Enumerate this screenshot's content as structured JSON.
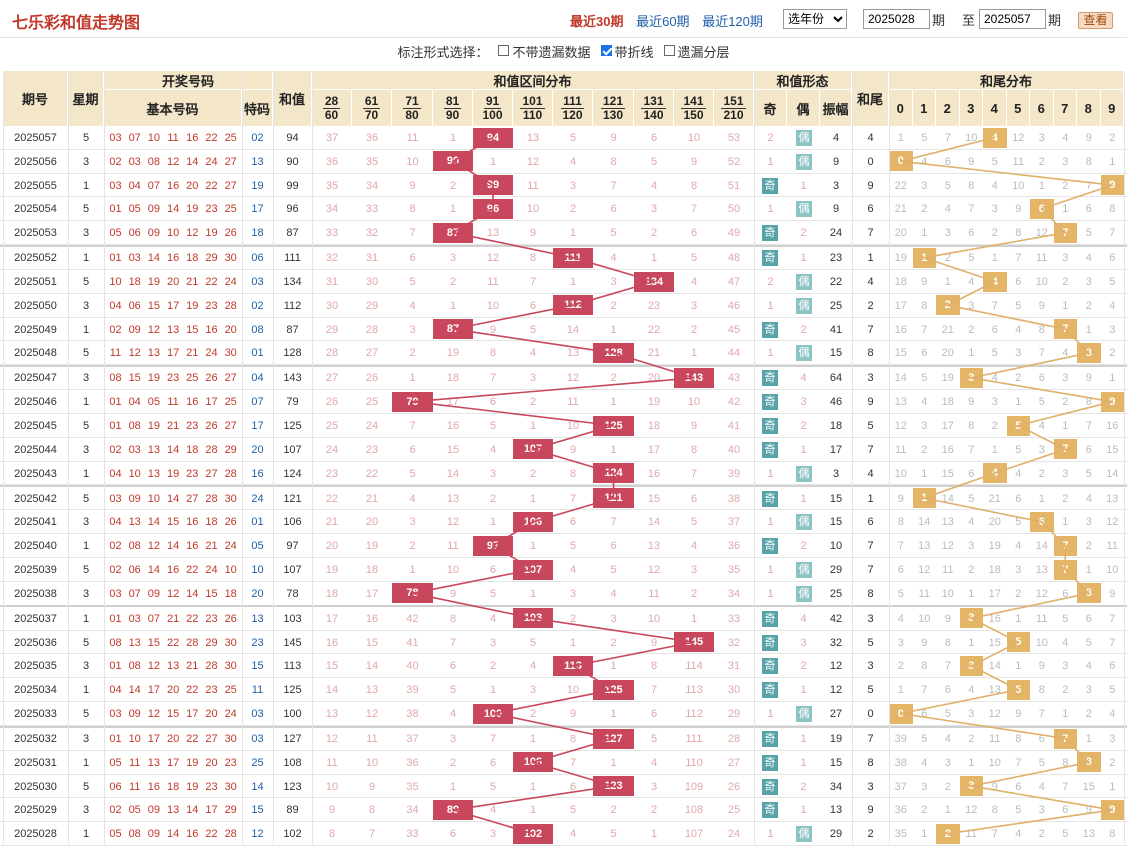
{
  "title": "七乐彩和值走势图",
  "periods": [
    "最近30期",
    "最近60期",
    "最近120期"
  ],
  "year_select": "选年份",
  "range": {
    "from": "2025028",
    "to": "2025057",
    "period_unit": "期",
    "to_label": "至",
    "query": "查看"
  },
  "options": {
    "label": "标注形式选择：",
    "items": [
      {
        "text": "不带遗漏数据",
        "checked": false
      },
      {
        "text": "带折线",
        "checked": true
      },
      {
        "text": "遗漏分层",
        "checked": false
      }
    ]
  },
  "headers": {
    "issue": "期号",
    "week": "星期",
    "draw": "开奖号码",
    "basic": "基本号码",
    "special": "特码",
    "sum": "和值",
    "range_dist": "和值区间分布",
    "form": "和值形态",
    "odd": "奇",
    "even": "偶",
    "amp": "振幅",
    "tail": "和尾",
    "tail_dist": "和尾分布"
  },
  "ranges": [
    [
      "28",
      "60"
    ],
    [
      "61",
      "70"
    ],
    [
      "71",
      "80"
    ],
    [
      "81",
      "90"
    ],
    [
      "91",
      "100"
    ],
    [
      "101",
      "110"
    ],
    [
      "111",
      "120"
    ],
    [
      "121",
      "130"
    ],
    [
      "131",
      "140"
    ],
    [
      "141",
      "150"
    ],
    [
      "151",
      "210"
    ]
  ],
  "tail_digits": [
    "0",
    "1",
    "2",
    "3",
    "4",
    "5",
    "6",
    "7",
    "8",
    "9"
  ],
  "colors": {
    "hit": "#c9475c",
    "tail_hit": "#e5b567",
    "tail_line": "#e0b06a",
    "header": "#f3e6c9"
  },
  "rows": [
    {
      "issue": "2025057",
      "week": "5",
      "nums": [
        "03",
        "07",
        "10",
        "11",
        "16",
        "22",
        "25"
      ],
      "sp": "02",
      "sum": "94",
      "r": [
        "37",
        "36",
        "11",
        "1",
        null,
        "13",
        "5",
        "9",
        "6",
        "10",
        "53"
      ],
      "odd": "2",
      "even": null,
      "amp": "4",
      "tail": "4",
      "t": [
        "1",
        "5",
        "7",
        "10",
        null,
        "12",
        "3",
        "4",
        "9",
        "2"
      ]
    },
    {
      "issue": "2025056",
      "week": "3",
      "nums": [
        "02",
        "03",
        "08",
        "12",
        "14",
        "24",
        "27"
      ],
      "sp": "13",
      "sum": "90",
      "r": [
        "36",
        "35",
        "10",
        null,
        "1",
        "12",
        "4",
        "8",
        "5",
        "9",
        "52"
      ],
      "odd": "1",
      "even": null,
      "amp": "9",
      "tail": "0",
      "t": [
        null,
        "4",
        "6",
        "9",
        "5",
        "11",
        "2",
        "3",
        "8",
        "1"
      ]
    },
    {
      "issue": "2025055",
      "week": "1",
      "nums": [
        "03",
        "04",
        "07",
        "16",
        "20",
        "22",
        "27"
      ],
      "sp": "19",
      "sum": "99",
      "r": [
        "35",
        "34",
        "9",
        "2",
        null,
        "11",
        "3",
        "7",
        "4",
        "8",
        "51"
      ],
      "odd": null,
      "even": "1",
      "amp": "3",
      "tail": "9",
      "t": [
        "22",
        "3",
        "5",
        "8",
        "4",
        "10",
        "1",
        "2",
        "7",
        null
      ]
    },
    {
      "issue": "2025054",
      "week": "5",
      "nums": [
        "01",
        "05",
        "09",
        "14",
        "19",
        "23",
        "25"
      ],
      "sp": "17",
      "sum": "96",
      "r": [
        "34",
        "33",
        "8",
        "1",
        null,
        "10",
        "2",
        "6",
        "3",
        "7",
        "50"
      ],
      "odd": "1",
      "even": null,
      "amp": "9",
      "tail": "6",
      "t": [
        "21",
        "2",
        "4",
        "7",
        "3",
        "9",
        null,
        "1",
        "6",
        "8"
      ]
    },
    {
      "issue": "2025053",
      "week": "3",
      "nums": [
        "05",
        "06",
        "09",
        "10",
        "12",
        "19",
        "26"
      ],
      "sp": "18",
      "sum": "87",
      "r": [
        "33",
        "32",
        "7",
        null,
        "13",
        "9",
        "1",
        "5",
        "2",
        "6",
        "49"
      ],
      "odd": null,
      "even": "2",
      "amp": "24",
      "tail": "7",
      "t": [
        "20",
        "1",
        "3",
        "6",
        "2",
        "8",
        "12",
        null,
        "5",
        "7"
      ]
    },
    {
      "issue": "2025052",
      "week": "1",
      "nums": [
        "01",
        "03",
        "14",
        "16",
        "18",
        "29",
        "30"
      ],
      "sp": "06",
      "sum": "111",
      "r": [
        "32",
        "31",
        "6",
        "3",
        "12",
        "8",
        null,
        "4",
        "1",
        "5",
        "48"
      ],
      "odd": null,
      "even": "1",
      "amp": "23",
      "tail": "1",
      "t": [
        "19",
        null,
        "2",
        "5",
        "1",
        "7",
        "11",
        "3",
        "4",
        "6"
      ]
    },
    {
      "issue": "2025051",
      "week": "5",
      "nums": [
        "10",
        "18",
        "19",
        "20",
        "21",
        "22",
        "24"
      ],
      "sp": "03",
      "sum": "134",
      "r": [
        "31",
        "30",
        "5",
        "2",
        "11",
        "7",
        "1",
        "3",
        null,
        "4",
        "47"
      ],
      "odd": "2",
      "even": null,
      "amp": "22",
      "tail": "4",
      "t": [
        "18",
        "9",
        "1",
        "4",
        null,
        "6",
        "10",
        "2",
        "3",
        "5"
      ]
    },
    {
      "issue": "2025050",
      "week": "3",
      "nums": [
        "04",
        "06",
        "15",
        "17",
        "19",
        "23",
        "28"
      ],
      "sp": "02",
      "sum": "112",
      "r": [
        "30",
        "29",
        "4",
        "1",
        "10",
        "6",
        null,
        "2",
        "23",
        "3",
        "46"
      ],
      "odd": "1",
      "even": null,
      "amp": "25",
      "tail": "2",
      "t": [
        "17",
        "8",
        null,
        "3",
        "7",
        "5",
        "9",
        "1",
        "2",
        "4"
      ]
    },
    {
      "issue": "2025049",
      "week": "1",
      "nums": [
        "02",
        "09",
        "12",
        "13",
        "15",
        "16",
        "20"
      ],
      "sp": "08",
      "sum": "87",
      "r": [
        "29",
        "28",
        "3",
        null,
        "9",
        "5",
        "14",
        "1",
        "22",
        "2",
        "45"
      ],
      "odd": null,
      "even": "2",
      "amp": "41",
      "tail": "7",
      "t": [
        "16",
        "7",
        "21",
        "2",
        "6",
        "4",
        "8",
        null,
        "1",
        "3"
      ]
    },
    {
      "issue": "2025048",
      "week": "5",
      "nums": [
        "11",
        "12",
        "13",
        "17",
        "21",
        "24",
        "30"
      ],
      "sp": "01",
      "sum": "128",
      "r": [
        "28",
        "27",
        "2",
        "19",
        "8",
        "4",
        "13",
        null,
        "21",
        "1",
        "44"
      ],
      "odd": "1",
      "even": null,
      "amp": "15",
      "tail": "8",
      "t": [
        "15",
        "6",
        "20",
        "1",
        "5",
        "3",
        "7",
        "4",
        null,
        "2"
      ]
    },
    {
      "issue": "2025047",
      "week": "3",
      "nums": [
        "08",
        "15",
        "19",
        "23",
        "25",
        "26",
        "27"
      ],
      "sp": "04",
      "sum": "143",
      "r": [
        "27",
        "26",
        "1",
        "18",
        "7",
        "3",
        "12",
        "2",
        "20",
        null,
        "43"
      ],
      "odd": null,
      "even": "4",
      "amp": "64",
      "tail": "3",
      "t": [
        "14",
        "5",
        "19",
        null,
        "4",
        "2",
        "6",
        "3",
        "9",
        "1"
      ]
    },
    {
      "issue": "2025046",
      "week": "1",
      "nums": [
        "01",
        "04",
        "05",
        "11",
        "16",
        "17",
        "25"
      ],
      "sp": "07",
      "sum": "79",
      "r": [
        "26",
        "25",
        null,
        "17",
        "6",
        "2",
        "11",
        "1",
        "19",
        "10",
        "42"
      ],
      "odd": null,
      "even": "3",
      "amp": "46",
      "tail": "9",
      "t": [
        "13",
        "4",
        "18",
        "9",
        "3",
        "1",
        "5",
        "2",
        "8",
        null
      ]
    },
    {
      "issue": "2025045",
      "week": "5",
      "nums": [
        "01",
        "08",
        "19",
        "21",
        "23",
        "26",
        "27"
      ],
      "sp": "17",
      "sum": "125",
      "r": [
        "25",
        "24",
        "7",
        "16",
        "5",
        "1",
        "10",
        null,
        "18",
        "9",
        "41"
      ],
      "odd": null,
      "even": "2",
      "amp": "18",
      "tail": "5",
      "t": [
        "12",
        "3",
        "17",
        "8",
        "2",
        null,
        "4",
        "1",
        "7",
        "16"
      ]
    },
    {
      "issue": "2025044",
      "week": "3",
      "nums": [
        "02",
        "03",
        "13",
        "14",
        "18",
        "28",
        "29"
      ],
      "sp": "20",
      "sum": "107",
      "r": [
        "24",
        "23",
        "6",
        "15",
        "4",
        null,
        "9",
        "1",
        "17",
        "8",
        "40"
      ],
      "odd": null,
      "even": "1",
      "amp": "17",
      "tail": "7",
      "t": [
        "11",
        "2",
        "16",
        "7",
        "1",
        "5",
        "3",
        null,
        "6",
        "15"
      ]
    },
    {
      "issue": "2025043",
      "week": "1",
      "nums": [
        "04",
        "10",
        "13",
        "19",
        "23",
        "27",
        "28"
      ],
      "sp": "16",
      "sum": "124",
      "r": [
        "23",
        "22",
        "5",
        "14",
        "3",
        "2",
        "8",
        null,
        "16",
        "7",
        "39"
      ],
      "odd": "1",
      "even": null,
      "amp": "3",
      "tail": "4",
      "t": [
        "10",
        "1",
        "15",
        "6",
        null,
        "4",
        "2",
        "3",
        "5",
        "14"
      ]
    },
    {
      "issue": "2025042",
      "week": "5",
      "nums": [
        "03",
        "09",
        "10",
        "14",
        "27",
        "28",
        "30"
      ],
      "sp": "24",
      "sum": "121",
      "r": [
        "22",
        "21",
        "4",
        "13",
        "2",
        "1",
        "7",
        null,
        "15",
        "6",
        "38"
      ],
      "odd": null,
      "even": "1",
      "amp": "15",
      "tail": "1",
      "t": [
        "9",
        null,
        "14",
        "5",
        "21",
        "6",
        "1",
        "2",
        "4",
        "13"
      ]
    },
    {
      "issue": "2025041",
      "week": "3",
      "nums": [
        "04",
        "13",
        "14",
        "15",
        "16",
        "18",
        "26"
      ],
      "sp": "01",
      "sum": "106",
      "r": [
        "21",
        "20",
        "3",
        "12",
        "1",
        null,
        "6",
        "7",
        "14",
        "5",
        "37"
      ],
      "odd": "1",
      "even": null,
      "amp": "15",
      "tail": "6",
      "t": [
        "8",
        "14",
        "13",
        "4",
        "20",
        "5",
        null,
        "1",
        "3",
        "12"
      ]
    },
    {
      "issue": "2025040",
      "week": "1",
      "nums": [
        "02",
        "08",
        "12",
        "14",
        "16",
        "21",
        "24"
      ],
      "sp": "05",
      "sum": "97",
      "r": [
        "20",
        "19",
        "2",
        "11",
        null,
        "1",
        "5",
        "6",
        "13",
        "4",
        "36"
      ],
      "odd": null,
      "even": "2",
      "amp": "10",
      "tail": "7",
      "t": [
        "7",
        "13",
        "12",
        "3",
        "19",
        "4",
        "14",
        null,
        "2",
        "11"
      ]
    },
    {
      "issue": "2025039",
      "week": "5",
      "nums": [
        "02",
        "06",
        "14",
        "16",
        "22",
        "24",
        "10"
      ],
      "sp": "10",
      "sum": "107",
      "r": [
        "19",
        "18",
        "1",
        "10",
        "6",
        null,
        "4",
        "5",
        "12",
        "3",
        "35"
      ],
      "odd": "1",
      "even": null,
      "amp": "29",
      "tail": "7",
      "t": [
        "6",
        "12",
        "11",
        "2",
        "18",
        "3",
        "13",
        null,
        "1",
        "10"
      ]
    },
    {
      "issue": "2025038",
      "week": "3",
      "nums": [
        "03",
        "07",
        "09",
        "12",
        "14",
        "15",
        "18"
      ],
      "sp": "20",
      "sum": "78",
      "r": [
        "18",
        "17",
        null,
        "9",
        "5",
        "1",
        "3",
        "4",
        "11",
        "2",
        "34"
      ],
      "odd": "1",
      "even": null,
      "amp": "25",
      "tail": "8",
      "t": [
        "5",
        "11",
        "10",
        "1",
        "17",
        "2",
        "12",
        "6",
        null,
        "9"
      ]
    },
    {
      "issue": "2025037",
      "week": "1",
      "nums": [
        "01",
        "03",
        "07",
        "21",
        "22",
        "23",
        "26"
      ],
      "sp": "13",
      "sum": "103",
      "r": [
        "17",
        "16",
        "42",
        "8",
        "4",
        null,
        "2",
        "3",
        "10",
        "1",
        "33"
      ],
      "odd": null,
      "even": "4",
      "amp": "42",
      "tail": "3",
      "t": [
        "4",
        "10",
        "9",
        null,
        "16",
        "1",
        "11",
        "5",
        "6",
        "7"
      ]
    },
    {
      "issue": "2025036",
      "week": "5",
      "nums": [
        "08",
        "13",
        "15",
        "22",
        "28",
        "29",
        "30"
      ],
      "sp": "23",
      "sum": "145",
      "r": [
        "16",
        "15",
        "41",
        "7",
        "3",
        "5",
        "1",
        "2",
        "9",
        null,
        "32"
      ],
      "odd": null,
      "even": "3",
      "amp": "32",
      "tail": "5",
      "t": [
        "3",
        "9",
        "8",
        "1",
        "15",
        null,
        "10",
        "4",
        "5",
        "7"
      ]
    },
    {
      "issue": "2025035",
      "week": "3",
      "nums": [
        "01",
        "08",
        "12",
        "13",
        "21",
        "28",
        "30"
      ],
      "sp": "15",
      "sum": "113",
      "r": [
        "15",
        "14",
        "40",
        "6",
        "2",
        "4",
        null,
        "1",
        "8",
        "114",
        "31"
      ],
      "odd": null,
      "even": "2",
      "amp": "12",
      "tail": "3",
      "t": [
        "2",
        "8",
        "7",
        null,
        "14",
        "1",
        "9",
        "3",
        "4",
        "6"
      ]
    },
    {
      "issue": "2025034",
      "week": "1",
      "nums": [
        "04",
        "14",
        "17",
        "20",
        "22",
        "23",
        "25"
      ],
      "sp": "11",
      "sum": "125",
      "r": [
        "14",
        "13",
        "39",
        "5",
        "1",
        "3",
        "10",
        null,
        "7",
        "113",
        "30"
      ],
      "odd": null,
      "even": "1",
      "amp": "12",
      "tail": "5",
      "t": [
        "1",
        "7",
        "6",
        "4",
        "13",
        null,
        "8",
        "2",
        "3",
        "5"
      ]
    },
    {
      "issue": "2025033",
      "week": "5",
      "nums": [
        "03",
        "09",
        "12",
        "15",
        "17",
        "20",
        "24"
      ],
      "sp": "03",
      "sum": "100",
      "r": [
        "13",
        "12",
        "38",
        "4",
        null,
        "2",
        "9",
        "1",
        "6",
        "112",
        "29"
      ],
      "odd": "1",
      "even": null,
      "amp": "27",
      "tail": "0",
      "t": [
        null,
        "6",
        "5",
        "3",
        "12",
        "9",
        "7",
        "1",
        "2",
        "4"
      ]
    },
    {
      "issue": "2025032",
      "week": "3",
      "nums": [
        "01",
        "10",
        "17",
        "20",
        "22",
        "27",
        "30"
      ],
      "sp": "03",
      "sum": "127",
      "r": [
        "12",
        "11",
        "37",
        "3",
        "7",
        "1",
        "8",
        null,
        "5",
        "111",
        "28"
      ],
      "odd": null,
      "even": "1",
      "amp": "19",
      "tail": "7",
      "t": [
        "39",
        "5",
        "4",
        "2",
        "11",
        "8",
        "6",
        null,
        "1",
        "3"
      ]
    },
    {
      "issue": "2025031",
      "week": "1",
      "nums": [
        "05",
        "11",
        "13",
        "17",
        "19",
        "20",
        "23"
      ],
      "sp": "25",
      "sum": "108",
      "r": [
        "11",
        "10",
        "36",
        "2",
        "6",
        null,
        "7",
        "1",
        "4",
        "110",
        "27"
      ],
      "odd": null,
      "even": "1",
      "amp": "15",
      "tail": "8",
      "t": [
        "38",
        "4",
        "3",
        "1",
        "10",
        "7",
        "5",
        "8",
        null,
        "2"
      ]
    },
    {
      "issue": "2025030",
      "week": "5",
      "nums": [
        "06",
        "11",
        "16",
        "18",
        "19",
        "23",
        "30"
      ],
      "sp": "14",
      "sum": "123",
      "r": [
        "10",
        "9",
        "35",
        "1",
        "5",
        "1",
        "6",
        null,
        "3",
        "109",
        "26"
      ],
      "odd": null,
      "even": "2",
      "amp": "34",
      "tail": "3",
      "t": [
        "37",
        "3",
        "2",
        null,
        "9",
        "6",
        "4",
        "7",
        "15",
        "1"
      ]
    },
    {
      "issue": "2025029",
      "week": "3",
      "nums": [
        "02",
        "05",
        "09",
        "13",
        "14",
        "17",
        "29"
      ],
      "sp": "15",
      "sum": "89",
      "r": [
        "9",
        "8",
        "34",
        null,
        "4",
        "1",
        "5",
        "2",
        "2",
        "108",
        "25"
      ],
      "odd": null,
      "even": "1",
      "amp": "13",
      "tail": "9",
      "t": [
        "36",
        "2",
        "1",
        "12",
        "8",
        "5",
        "3",
        "6",
        "9",
        null
      ]
    },
    {
      "issue": "2025028",
      "week": "1",
      "nums": [
        "05",
        "08",
        "09",
        "14",
        "16",
        "22",
        "28"
      ],
      "sp": "12",
      "sum": "102",
      "r": [
        "8",
        "7",
        "33",
        "6",
        "3",
        null,
        "4",
        "5",
        "1",
        "107",
        "24"
      ],
      "odd": "1",
      "even": null,
      "amp": "29",
      "tail": "2",
      "t": [
        "35",
        "1",
        null,
        "11",
        "7",
        "4",
        "2",
        "5",
        "13",
        "8"
      ]
    }
  ]
}
